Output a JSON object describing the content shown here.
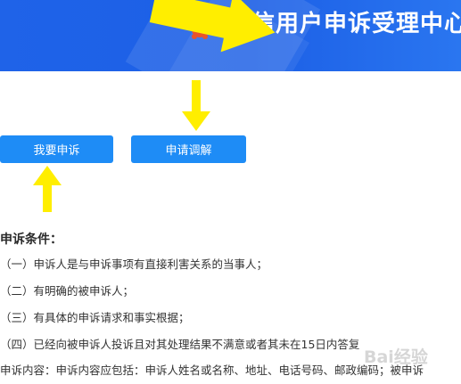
{
  "banner": {
    "title": "信用户申诉受理中心",
    "colors": {
      "background": "#1f63e8",
      "text": "#ffffff"
    },
    "emblem_icon": "emblem-icon"
  },
  "actions": {
    "complaint_label": "我要申诉",
    "mediation_label": "申请调解",
    "button_color": "#1e8cf6"
  },
  "conditions": {
    "heading": "申诉条件：",
    "items": [
      "（一）申诉人是与申诉事项有直接利害关系的当事人；",
      "（二）有明确的被申诉人；",
      "（三）有具体的申诉请求和事实根据；",
      "（四）已经向被申诉人投诉且对其处理结果不满意或者其未在15日内答复"
    ],
    "content_line": "申诉内容：申诉内容应包括：申诉人姓名或名称、地址、电话号码、邮政编码；被申诉"
  },
  "annotations": {
    "arrow_color": "#ffee00",
    "arrow_icons": [
      "arrow-right-icon",
      "arrow-down-icon",
      "arrow-up-icon"
    ]
  },
  "watermark": {
    "text": "Bai经验"
  }
}
